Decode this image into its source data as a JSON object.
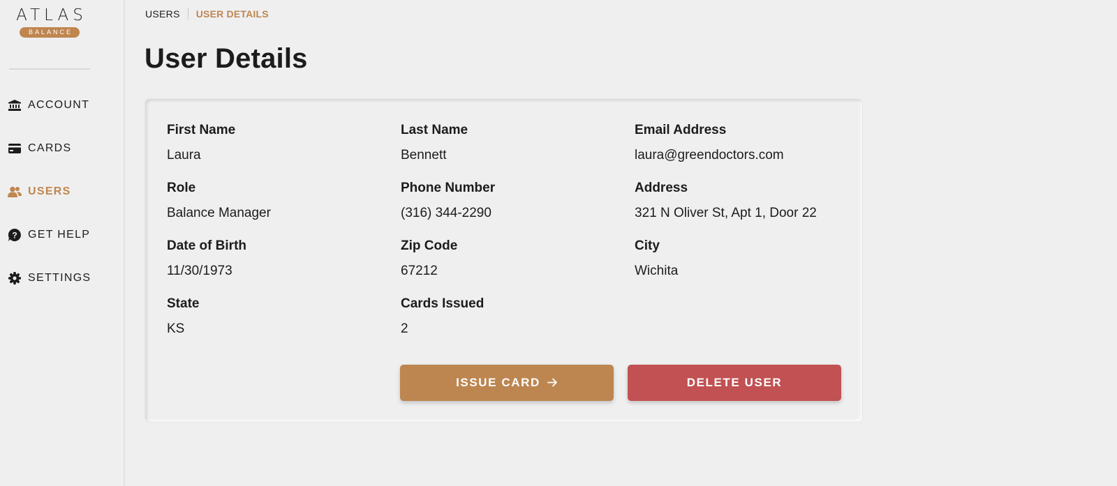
{
  "logo": {
    "word": "ATLAS",
    "badge": "BALANCE"
  },
  "sidebar": {
    "items": [
      {
        "label": "ACCOUNT",
        "icon": "bank-icon",
        "active": false
      },
      {
        "label": "CARDS",
        "icon": "credit-card-icon",
        "active": false
      },
      {
        "label": "USERS",
        "icon": "users-icon",
        "active": true
      },
      {
        "label": "GET HELP",
        "icon": "help-icon",
        "active": false
      },
      {
        "label": "SETTINGS",
        "icon": "gear-icon",
        "active": false
      }
    ]
  },
  "breadcrumb": {
    "parent": "USERS",
    "current": "USER DETAILS"
  },
  "page": {
    "title": "User Details"
  },
  "details": {
    "fields": [
      {
        "label": "First Name",
        "value": "Laura"
      },
      {
        "label": "Last Name",
        "value": "Bennett"
      },
      {
        "label": "Email Address",
        "value": "laura@greendoctors.com"
      },
      {
        "label": "Role",
        "value": "Balance Manager"
      },
      {
        "label": "Phone Number",
        "value": "(316) 344-2290"
      },
      {
        "label": "Address",
        "value": "321 N Oliver St, Apt 1, Door 22"
      },
      {
        "label": "Date of Birth",
        "value": "11/30/1973"
      },
      {
        "label": "Zip Code",
        "value": "67212"
      },
      {
        "label": "City",
        "value": "Wichita"
      },
      {
        "label": "State",
        "value": "KS"
      },
      {
        "label": "Cards Issued",
        "value": "2"
      }
    ]
  },
  "actions": {
    "issue_card": "ISSUE CARD",
    "delete_user": "DELETE USER"
  },
  "colors": {
    "accent": "#bf8650",
    "danger": "#c15152",
    "background": "#efefef",
    "text": "#1c1c1c"
  }
}
